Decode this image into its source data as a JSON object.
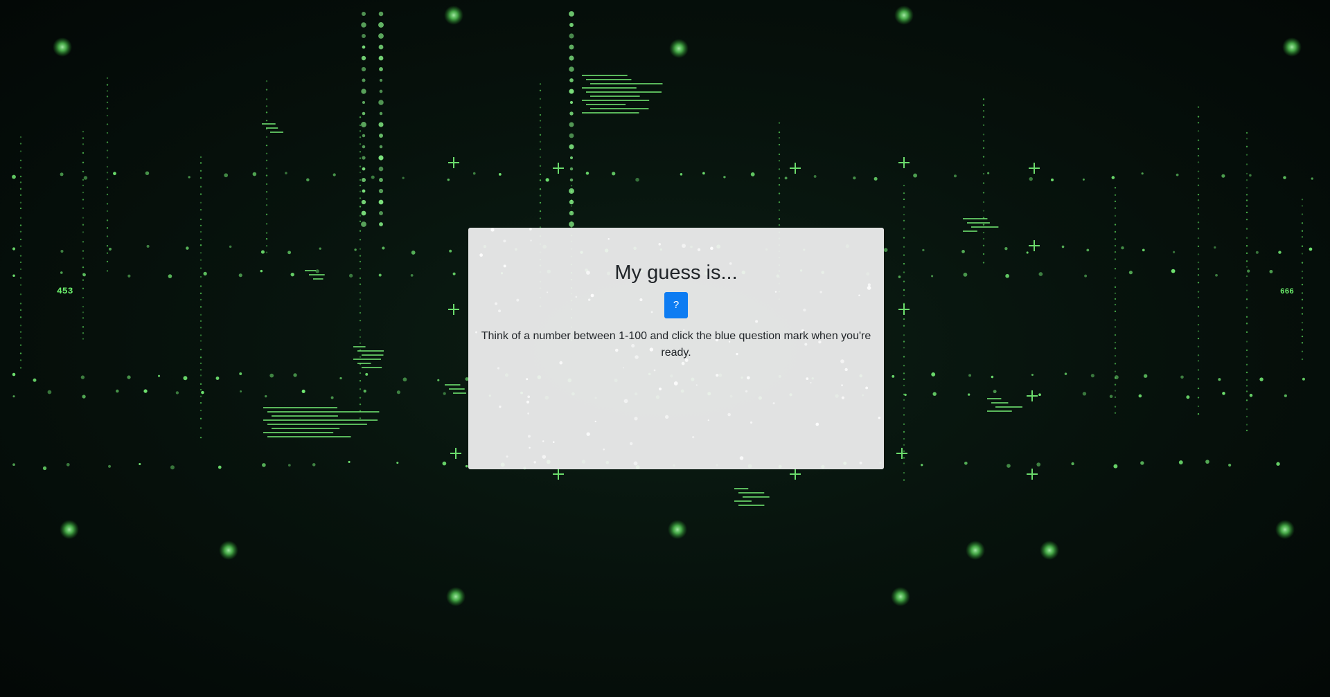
{
  "page": {
    "background_color": "#07130d",
    "accent_green": "#6cf06c"
  },
  "dialog": {
    "title": "My guess is...",
    "guess_button_label": "?",
    "guess_button_color": "#0d7cf2",
    "instructions": "Think of a number between 1-100 and click the blue question mark when you're ready."
  },
  "background_labels": [
    "453",
    "666"
  ]
}
